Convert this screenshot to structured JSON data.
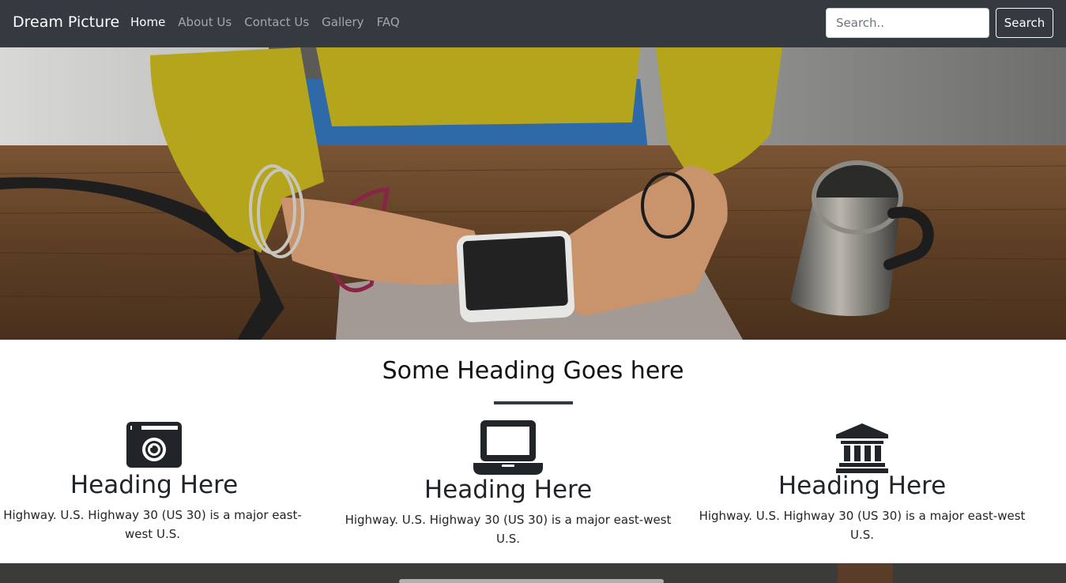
{
  "navbar": {
    "brand": "Dream Picture",
    "links": [
      {
        "label": "Home",
        "active": true
      },
      {
        "label": "About Us",
        "active": false
      },
      {
        "label": "Contact Us",
        "active": false
      },
      {
        "label": "Gallery",
        "active": false
      },
      {
        "label": "FAQ",
        "active": false
      }
    ],
    "search": {
      "placeholder": "Search..",
      "value": "",
      "button_label": "Search"
    }
  },
  "hero": {
    "image": "woman-in-yellow-sweater-holding-smartphone-at-wooden-desk"
  },
  "section": {
    "heading": "Some Heading Goes here",
    "features": [
      {
        "icon": "camera-icon",
        "title": "Heading Here",
        "text": "Highway. U.S. Highway 30 (US 30) is a major east-west U.S."
      },
      {
        "icon": "laptop-icon",
        "title": "Heading Here",
        "text": "Highway. U.S. Highway 30 (US 30) is a major east-west U.S."
      },
      {
        "icon": "bank-icon",
        "title": "Heading Here",
        "text": "Highway. U.S. Highway 30 (US 30) is a major east-west U.S."
      }
    ]
  },
  "colors": {
    "navbar_bg": "#343a40",
    "divider": "#343a40",
    "icon": "#212529"
  }
}
